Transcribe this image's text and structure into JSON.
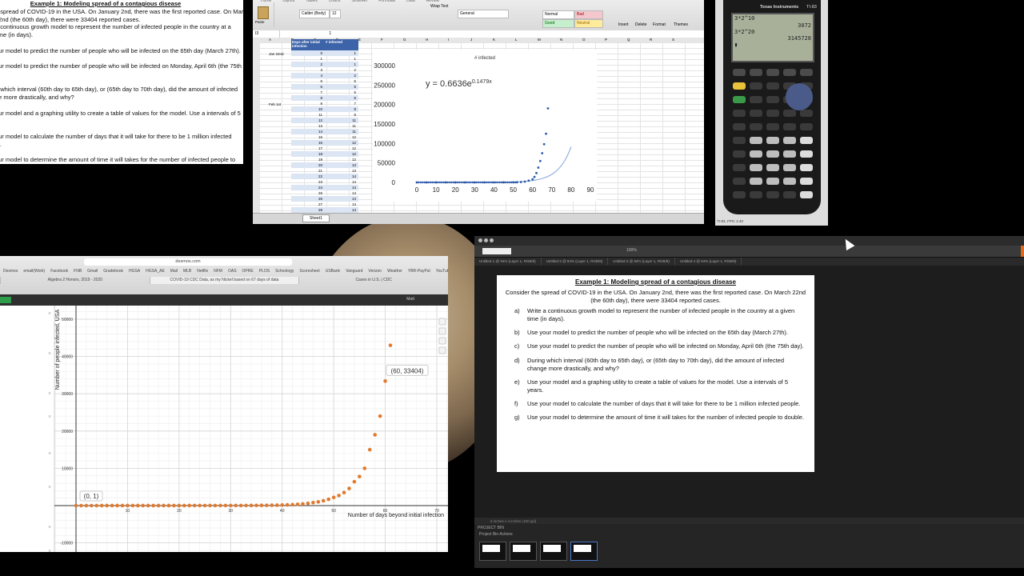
{
  "doc_window": {
    "title": "Example 1:  Modeling spread of a contagious disease",
    "lines": [
      "e spread of COVID-19 in the USA.  On January 2nd, there was the first reported case.  On March",
      "22nd (the 60th day), there were 33404 reported cases.",
      "a continuous growth model to represent the number of infected people in the country at a",
      "time (in days).",
      "",
      "our model to predict the number of people who will be infected on the 65th day (March 27th).",
      "",
      "our model to predict the number of people who will be infected on Monday, April 6th (the 75th",
      "",
      "",
      "g which interval (60th day to 65th day), or (65th day to 70th day), did the amount of infected",
      "ge more drastically, and why?",
      "",
      "our model and a graphing utility to create a table of values for the model.  Use a intervals of 5",
      "",
      "",
      "our model to calculate the number of days that it will take for there to be 1 million infected",
      "le.",
      "",
      "our model to determine the amount of time it will takes for the number of infected people to",
      "ble."
    ]
  },
  "excel": {
    "name_box": "I3",
    "formula_value": "1",
    "col_headers": [
      "A",
      "B",
      "C",
      "D",
      "E",
      "F",
      "G",
      "H",
      "I",
      "J",
      "K",
      "L",
      "M",
      "N",
      "O",
      "P",
      "Q",
      "R",
      "S"
    ],
    "ribbon_tabs": [
      "Home",
      "Layout",
      "Tables",
      "Charts",
      "SmartArt",
      "Formulas",
      "Data",
      "Review"
    ],
    "ribbon_labels": {
      "font_name": "Calibri (Body)",
      "font_size": "12",
      "number_format": "General",
      "style_normal": "Normal",
      "style_bad": "Bad",
      "style_good": "Good",
      "style_neutral": "Neutral",
      "wrap": "Wrap Text",
      "insert": "Insert",
      "delete": "Delete",
      "format": "Format",
      "themes": "Themes",
      "paste": "Paste"
    },
    "table_header": [
      "Days after initial infection",
      "# infected"
    ],
    "row_labels": {
      "jan": "Jan 22nd",
      "feb": "Feb 1st"
    },
    "days": [
      0,
      1,
      2,
      3,
      4,
      5,
      6,
      7,
      8,
      9,
      10,
      11,
      12,
      13,
      14,
      15,
      16,
      17,
      18,
      19,
      20,
      21,
      22,
      23,
      24,
      25,
      26,
      27,
      28,
      29,
      30,
      31
    ],
    "infected": [
      1,
      1,
      1,
      2,
      2,
      5,
      5,
      5,
      5,
      7,
      8,
      8,
      11,
      11,
      11,
      12,
      12,
      12,
      12,
      12,
      13,
      13,
      14,
      14,
      14,
      14,
      14,
      14,
      14,
      14,
      15,
      15
    ],
    "sheet_tab": "Sheet1",
    "chart_title": "# infected",
    "equation_base": "y = 0.6636e",
    "equation_exp": "0.1479x"
  },
  "chart_data": [
    {
      "type": "scatter",
      "title": "# infected",
      "xlim": [
        0,
        90
      ],
      "ylim": [
        0,
        300000
      ],
      "x_ticks": [
        0,
        10,
        20,
        30,
        40,
        50,
        60,
        70,
        80,
        90
      ],
      "y_ticks": [
        0,
        50000,
        100000,
        150000,
        200000,
        250000,
        300000
      ],
      "trendline": "y = 0.6636e^0.1479x",
      "series": [
        {
          "x": [
            0,
            5,
            10,
            15,
            20,
            25,
            30,
            35,
            40,
            45,
            50,
            52,
            54,
            56,
            58,
            60,
            61,
            62,
            63,
            64,
            65,
            66,
            67,
            68
          ],
          "y": [
            1,
            5,
            8,
            12,
            13,
            14,
            15,
            20,
            60,
            100,
            200,
            500,
            1000,
            2000,
            4500,
            8000,
            14000,
            24000,
            38000,
            55000,
            75000,
            98000,
            125000,
            190000
          ]
        }
      ]
    },
    {
      "type": "scatter",
      "xlabel": "Number of days beyond initial infection",
      "ylabel": "Number of people infected, USA",
      "xlim": [
        0,
        70
      ],
      "ylim": [
        -10000,
        50000
      ],
      "x_ticks": [
        0,
        10,
        20,
        30,
        40,
        50,
        60,
        70
      ],
      "y_ticks": [
        -10000,
        0,
        10000,
        20000,
        30000,
        40000,
        50000
      ],
      "annotations": [
        "(0, 1)",
        "(60, 33404)"
      ],
      "series": [
        {
          "x": [
            0,
            1,
            2,
            3,
            4,
            5,
            6,
            7,
            8,
            9,
            10,
            11,
            12,
            13,
            14,
            15,
            16,
            17,
            18,
            19,
            20,
            21,
            22,
            23,
            24,
            25,
            26,
            27,
            28,
            29,
            30,
            31,
            32,
            33,
            34,
            35,
            36,
            37,
            38,
            39,
            40,
            41,
            42,
            43,
            44,
            45,
            46,
            47,
            48,
            49,
            50,
            51,
            52,
            53,
            54,
            55,
            56,
            57,
            58,
            59,
            60,
            61
          ],
          "y": [
            1,
            1,
            1,
            2,
            2,
            5,
            5,
            5,
            5,
            7,
            8,
            8,
            11,
            11,
            11,
            12,
            12,
            12,
            12,
            12,
            13,
            13,
            14,
            14,
            14,
            14,
            14,
            14,
            14,
            14,
            15,
            15,
            20,
            25,
            35,
            50,
            60,
            70,
            100,
            120,
            150,
            200,
            250,
            350,
            450,
            600,
            800,
            1000,
            1300,
            1700,
            2200,
            2700,
            3500,
            4600,
            6400,
            7800,
            10000,
            15000,
            19000,
            24000,
            33404,
            43000
          ]
        }
      ]
    }
  ],
  "calculator": {
    "brand": "Texas Instruments",
    "model": "TI-83",
    "screen_lines": [
      {
        "expr": "3*2^10",
        "result": "3072"
      },
      {
        "expr": "3*2^20",
        "result": "3145728"
      }
    ],
    "footer": "TI-83, FPS: 2.40"
  },
  "desmos": {
    "url": "desmos.com",
    "bookmarks": [
      "Desmos",
      "email(Work)",
      "Facebook",
      "FNB",
      "Gmail",
      "Gradebook",
      "HGSA",
      "HGSA_AE",
      "Mail",
      "MLB",
      "Netflix",
      "NFM",
      "OAS",
      "OPRE",
      "PLOS",
      "Schoology",
      "Scoresheet",
      "USBank",
      "Vanguard",
      "Verizon",
      "Weather",
      "YBR-PayPal",
      "YouTube"
    ],
    "tabs": [
      "Algebra 2 Honors, 2019 - 2020",
      "COVID-19 CDC Data, as my Nickel based on 67 days of data",
      "Cases in U.S. | CDC"
    ],
    "user": "Matt"
  },
  "viewer": {
    "tabs": [
      "Untitled-1 @ 94% (Layer 1, RGB/8)",
      "Untitled-2 @ 94% (Layer 1, RGB/8)",
      "Untitled-3 @ 94% (Layer 1, RGB/8)",
      "Untitled-4 @ 94% (Layer 1, RGB/8)"
    ],
    "zoom": "100%",
    "status": "6 inches x 4 inches (150 ppi)",
    "panel_title": "PROJECT BIN",
    "panel_sub": "Project Bin Actions",
    "page": {
      "title": "Example 1:  Modeling spread of a contagious disease",
      "intro": "Consider the spread of COVID-19 in the USA.  On January 2nd, there was the first reported case.  On March 22nd (the 60th day), there were 33404 reported cases.",
      "items": [
        {
          "label": "a)",
          "text": "Write a continuous growth model to represent the number of infected people in the country at a given time (in days)."
        },
        {
          "label": "b)",
          "text": "Use your model to predict the number of people who will be infected on the 65th day (March 27th)."
        },
        {
          "label": "c)",
          "text": "Use your model to predict the number of people who will be infected on Monday, April 6th (the 75th day)."
        },
        {
          "label": "d)",
          "text": "During which interval (60th day to 65th day), or (65th day to 70th day), did the amount of infected change more drastically, and why?"
        },
        {
          "label": "e)",
          "text": "Use your model and a graphing utility to create a table of values for the model.  Use a intervals of 5 years."
        },
        {
          "label": "f)",
          "text": "Use your model to calculate the number of days that it will take for there to be 1 million infected people."
        },
        {
          "label": "g)",
          "text": "Use your model to determine the amount of time it will takes for the number of infected people to double."
        }
      ]
    }
  }
}
